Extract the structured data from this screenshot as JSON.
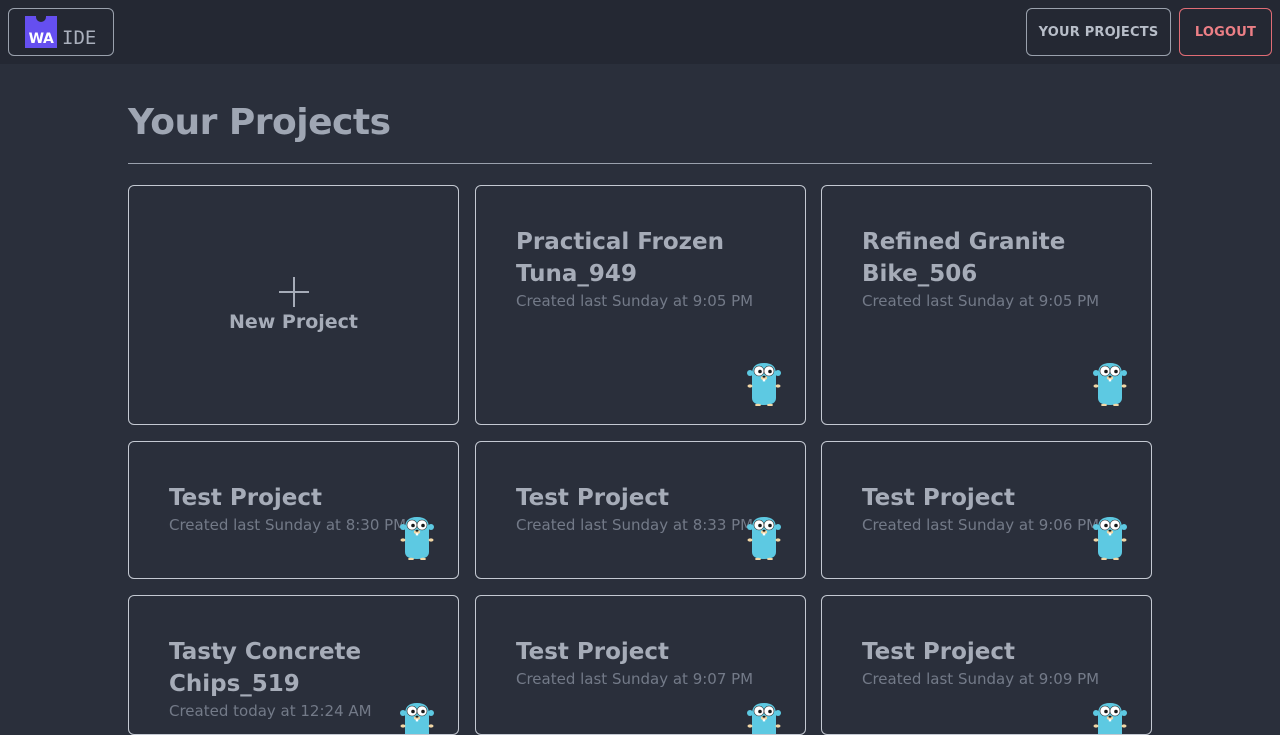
{
  "header": {
    "logo_mark": "WA",
    "logo_text": "IDE",
    "your_projects_label": "YOUR PROJECTS",
    "logout_label": "LOGOUT"
  },
  "main": {
    "title": "Your Projects",
    "new_project_label": "New Project",
    "projects": [
      {
        "title": "Practical Frozen Tuna_949",
        "created": "Created last Sunday at 9:05 PM",
        "icon": "gopher-icon"
      },
      {
        "title": "Refined Granite Bike_506",
        "created": "Created last Sunday at 9:05 PM",
        "icon": "gopher-icon"
      },
      {
        "title": "Test Project",
        "created": "Created last Sunday at 8:30 PM",
        "icon": "gopher-icon"
      },
      {
        "title": "Test Project",
        "created": "Created last Sunday at 8:33 PM",
        "icon": "gopher-icon"
      },
      {
        "title": "Test Project",
        "created": "Created last Sunday at 9:06 PM",
        "icon": "gopher-icon"
      },
      {
        "title": "Tasty Concrete Chips_519",
        "created": "Created today at 12:24 AM",
        "icon": "gopher-icon"
      },
      {
        "title": "Test Project",
        "created": "Created last Sunday at 9:07 PM",
        "icon": "gopher-icon"
      },
      {
        "title": "Test Project",
        "created": "Created last Sunday at 9:09 PM",
        "icon": "gopher-icon"
      }
    ]
  },
  "colors": {
    "background": "#2a2f3b",
    "topbar": "#242833",
    "logo_accent": "#654ff0",
    "logout_accent": "#e06c75",
    "gopher": "#5dc9e2"
  }
}
